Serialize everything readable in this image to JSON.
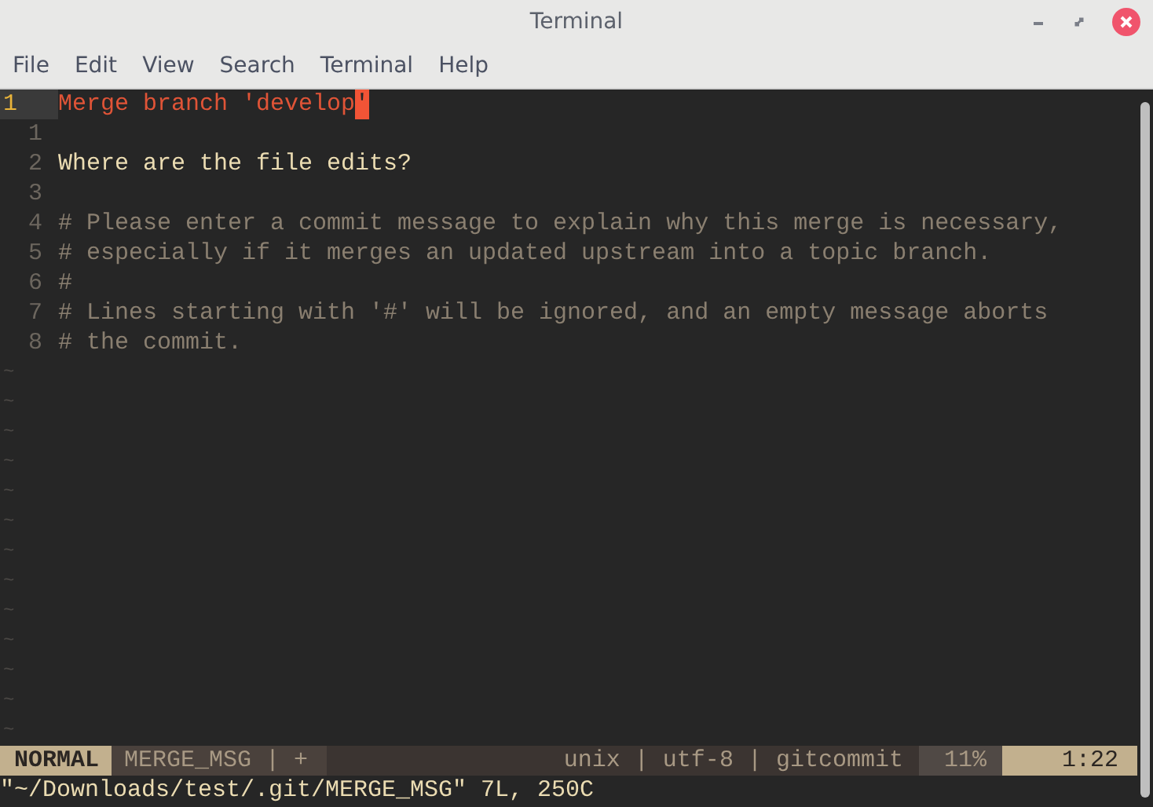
{
  "window": {
    "title": "Terminal"
  },
  "menu": [
    "File",
    "Edit",
    "View",
    "Search",
    "Terminal",
    "Help"
  ],
  "lines": [
    {
      "number": "1",
      "kind": "current",
      "text": "Merge branch 'develop",
      "cursor_char": "'"
    },
    {
      "number": "1",
      "kind": "blank"
    },
    {
      "number": "2",
      "kind": "heading",
      "text": "Where are the file edits?"
    },
    {
      "number": "3",
      "kind": "blank"
    },
    {
      "number": "4",
      "kind": "comment",
      "text": "# Please enter a commit message to explain why this merge is necessary,"
    },
    {
      "number": "5",
      "kind": "comment",
      "text": "# especially if it merges an updated upstream into a topic branch."
    },
    {
      "number": "6",
      "kind": "comment",
      "text": "#"
    },
    {
      "number": "7",
      "kind": "comment",
      "text": "# Lines starting with '#' will be ignored, and an empty message aborts"
    },
    {
      "number": "8",
      "kind": "comment",
      "text": "# the commit."
    }
  ],
  "empty_line_markers": [
    "~",
    "~",
    "~",
    "~",
    "~",
    "~",
    "~",
    "~",
    "~",
    "~",
    "~",
    "~",
    "~"
  ],
  "status_line": {
    "mode": "NORMAL",
    "file": "MERGE_MSG | +",
    "file_info": "unix | utf-8 | gitcommit",
    "percent": "11%",
    "position": "1:22"
  },
  "command_line": "\"~/Downloads/test/.git/MERGE_MSG\" 7L, 250C"
}
